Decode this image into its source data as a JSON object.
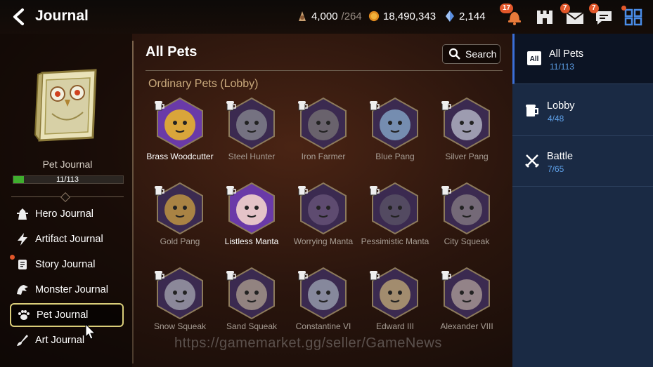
{
  "header": {
    "title": "Journal",
    "resources": [
      {
        "icon": "stamina-icon",
        "value": "4,000",
        "suffix": "/264"
      },
      {
        "icon": "gold-coin-icon",
        "value": "18,490,343",
        "suffix": ""
      },
      {
        "icon": "crystal-icon",
        "value": "2,144",
        "suffix": ""
      }
    ],
    "badges": {
      "notifications": "17",
      "mail": "7",
      "chat": "7"
    }
  },
  "left_panel": {
    "book_label": "Pet Journal",
    "progress_text": "11/113",
    "progress_fraction": 0.097,
    "nav": [
      {
        "label": "Hero Journal",
        "icon": "hero-icon",
        "selected": false,
        "dot": false
      },
      {
        "label": "Artifact Journal",
        "icon": "lightning-icon",
        "selected": false,
        "dot": false
      },
      {
        "label": "Story Journal",
        "icon": "scroll-icon",
        "selected": false,
        "dot": true
      },
      {
        "label": "Monster Journal",
        "icon": "monster-icon",
        "selected": false,
        "dot": false
      },
      {
        "label": "Pet Journal",
        "icon": "paw-icon",
        "selected": true,
        "dot": false
      },
      {
        "label": "Art Journal",
        "icon": "brush-icon",
        "selected": false,
        "dot": false
      }
    ]
  },
  "main": {
    "title": "All Pets",
    "search_label": "Search",
    "section_title": "Ordinary Pets (Lobby)",
    "pets": [
      {
        "name": "Brass Woodcutter",
        "owned": true,
        "color": "#d9a53a"
      },
      {
        "name": "Steel Hunter",
        "owned": false,
        "color": "#8f9296"
      },
      {
        "name": "Iron Farmer",
        "owned": false,
        "color": "#7d7a78"
      },
      {
        "name": "Blue Pang",
        "owned": false,
        "color": "#8fb8d9"
      },
      {
        "name": "Silver Pang",
        "owned": false,
        "color": "#c7cdd8"
      },
      {
        "name": "Gold Pang",
        "owned": false,
        "color": "#d8aa3f"
      },
      {
        "name": "Listless Manta",
        "owned": true,
        "color": "#e4c3c8"
      },
      {
        "name": "Worrying Manta",
        "owned": false,
        "color": "#6d5a7d"
      },
      {
        "name": "Pessimistic Manta",
        "owned": false,
        "color": "#5e5968"
      },
      {
        "name": "City Squeak",
        "owned": false,
        "color": "#8d8488"
      },
      {
        "name": "Snow Squeak",
        "owned": false,
        "color": "#aeb1b8"
      },
      {
        "name": "Sand Squeak",
        "owned": false,
        "color": "#b8a994"
      },
      {
        "name": "Constantine VI",
        "owned": false,
        "color": "#a6b0bc"
      },
      {
        "name": "Edward III",
        "owned": false,
        "color": "#cfb67a"
      },
      {
        "name": "Alexander VIII",
        "owned": false,
        "color": "#b9a9a0"
      }
    ],
    "watermark": "https://gamemarket.gg/seller/GameNews"
  },
  "right_panel": {
    "tabs": [
      {
        "label": "All Pets",
        "count": "11/113",
        "icon": "all-icon",
        "selected": true
      },
      {
        "label": "Lobby",
        "count": "4/48",
        "icon": "mug-icon",
        "selected": false
      },
      {
        "label": "Battle",
        "count": "7/65",
        "icon": "crossed-swords-icon",
        "selected": false
      }
    ]
  },
  "colors": {
    "accent_green": "#3fae2e",
    "accent_blue": "#5ea0e8",
    "section_gold": "#c9a97c",
    "badge_orange": "#e2572a"
  }
}
